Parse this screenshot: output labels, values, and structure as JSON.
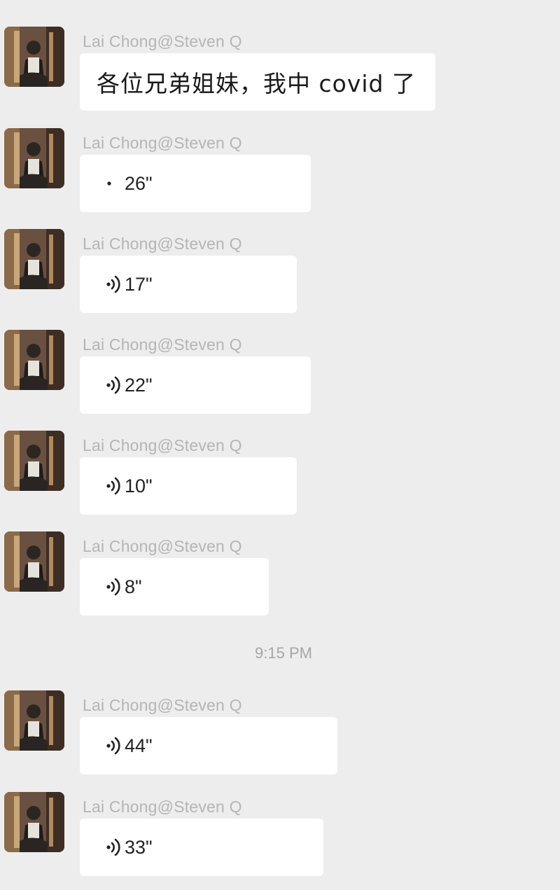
{
  "conversation": {
    "messages": [
      {
        "sender": "Lai Chong@Steven Q",
        "type": "text",
        "text": "各位兄弟姐妹，我中 covid 了"
      },
      {
        "sender": "Lai Chong@Steven Q",
        "type": "voice",
        "duration": "26\"",
        "icon": "voice-wave-icon"
      },
      {
        "sender": "Lai Chong@Steven Q",
        "type": "voice",
        "duration": "17\"",
        "icon": "voice-wave-icon"
      },
      {
        "sender": "Lai Chong@Steven Q",
        "type": "voice",
        "duration": "22\"",
        "icon": "voice-wave-icon"
      },
      {
        "sender": "Lai Chong@Steven Q",
        "type": "voice",
        "duration": "10\"",
        "icon": "voice-wave-icon"
      },
      {
        "sender": "Lai Chong@Steven Q",
        "type": "voice",
        "duration": "8\"",
        "icon": "voice-wave-icon"
      },
      {
        "sender": "Lai Chong@Steven Q",
        "type": "voice",
        "duration": "44\"",
        "icon": "voice-wave-icon"
      },
      {
        "sender": "Lai Chong@Steven Q",
        "type": "voice",
        "duration": "33\"",
        "icon": "voice-wave-icon"
      }
    ],
    "timestamp": "9:15 PM"
  },
  "colors": {
    "background": "#ededed",
    "bubble": "#ffffff",
    "sender_text": "#b5b5b5",
    "timestamp_text": "#a6a6a6"
  }
}
